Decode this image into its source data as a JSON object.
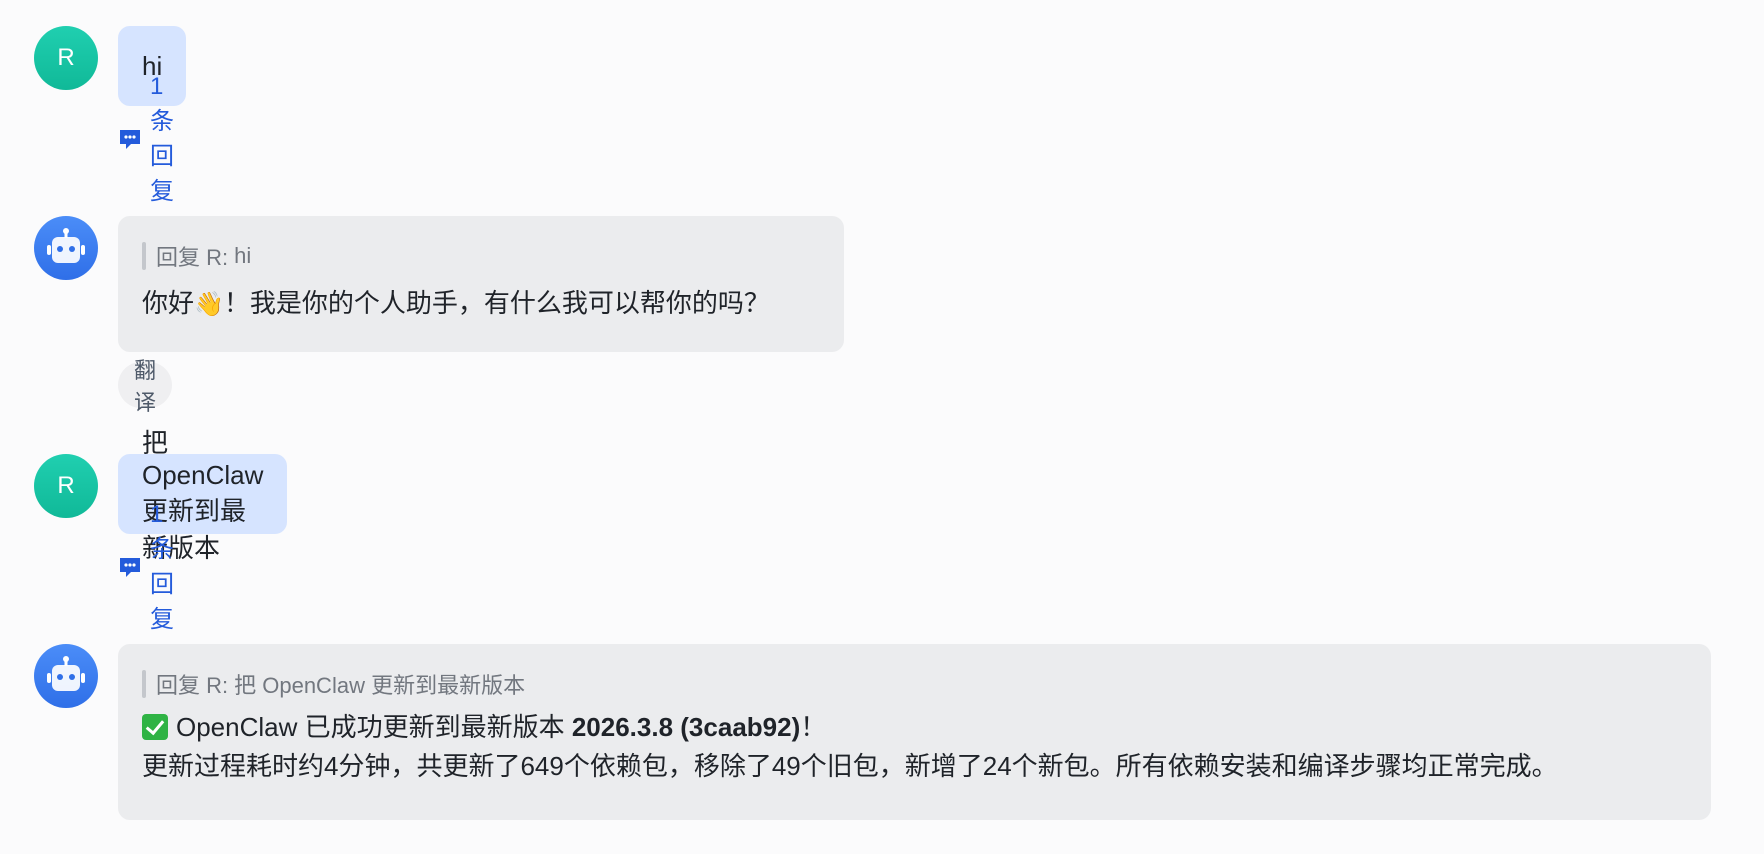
{
  "messages": [
    {
      "sender": "user",
      "avatar_initial": "R",
      "text": "hi",
      "reply_count": "1 条回复"
    },
    {
      "sender": "bot",
      "quote_prefix": "回复 R:",
      "quote_text": "hi",
      "text_before_emoji": "你好",
      "emoji": "👋",
      "text_after_emoji": "！我是你的个人助手，有什么我可以帮你的吗？",
      "action_translate": "翻译"
    },
    {
      "sender": "user",
      "avatar_initial": "R",
      "text": "把 OpenClaw 更新到最新版本",
      "reply_count": "1 条回复"
    },
    {
      "sender": "bot",
      "quote_prefix": "回复 R:",
      "quote_text": "把 OpenClaw 更新到最新版本",
      "line1_prefix": "OpenClaw 已成功更新到最新版本 ",
      "line1_bold": "2026.3.8 (3caab92)",
      "line1_suffix": "！",
      "line2": "更新过程耗时约4分钟，共更新了649个依赖包，移除了49个旧包，新增了24个新包。所有依赖安装和编译步骤均正常完成。"
    }
  ],
  "icons": {
    "reply": "comment-dots-icon",
    "bot_avatar": "robot-icon",
    "success": "check-mark-icon"
  },
  "colors": {
    "user_bubble": "#d6e4ff",
    "bot_bubble": "#ebecee",
    "user_avatar": "#14c2a3",
    "bot_avatar": "#3a7ef0",
    "link": "#245bdb"
  }
}
